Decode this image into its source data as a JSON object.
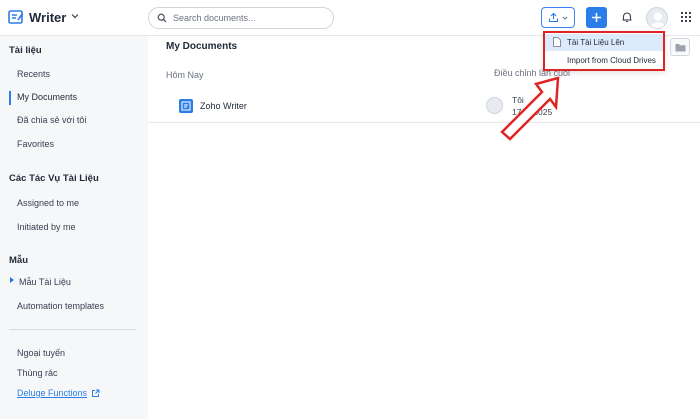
{
  "header": {
    "app_name": "Writer",
    "search_placeholder": "Search documents...",
    "brand_color": "#2b7de9"
  },
  "sidebar": {
    "section_documents": "Tài liệu",
    "items_documents": [
      "Recents",
      "My Documents",
      "Đã chia sẻ với tôi",
      "Favorites"
    ],
    "section_tasks": "Các Tác Vụ Tài Liệu",
    "items_tasks": [
      "Assigned to me",
      "Initiated by me"
    ],
    "section_templates": "Mẫu",
    "items_templates": [
      "Mẫu Tài Liệu",
      "Automation templates"
    ],
    "items_bottom": [
      "Ngoại tuyến",
      "Thùng rác"
    ],
    "deluge_label": "Deluge Functions",
    "active_item": "My Documents"
  },
  "main": {
    "title": "My Documents",
    "group_label": "Hôm Nay",
    "modified_header": "Điều chỉnh lần cuối",
    "documents": [
      {
        "name": "Zoho Writer",
        "owner": "Tôi",
        "date": "17 th   2025"
      }
    ]
  },
  "upload_menu": {
    "items": [
      "Tải Tài Liệu Lên",
      "Import from Cloud Drives"
    ],
    "highlighted": "Tải Tài Liệu Lên",
    "annotation_color": "#e02424"
  },
  "icons": [
    "writer-logo-icon",
    "chevron-down-icon",
    "search-icon",
    "upload-icon",
    "plus-icon",
    "bell-icon",
    "avatar",
    "apps-grid-icon",
    "folder-icon",
    "document-icon",
    "file-icon",
    "external-link-icon",
    "red-arrow-annotation"
  ]
}
